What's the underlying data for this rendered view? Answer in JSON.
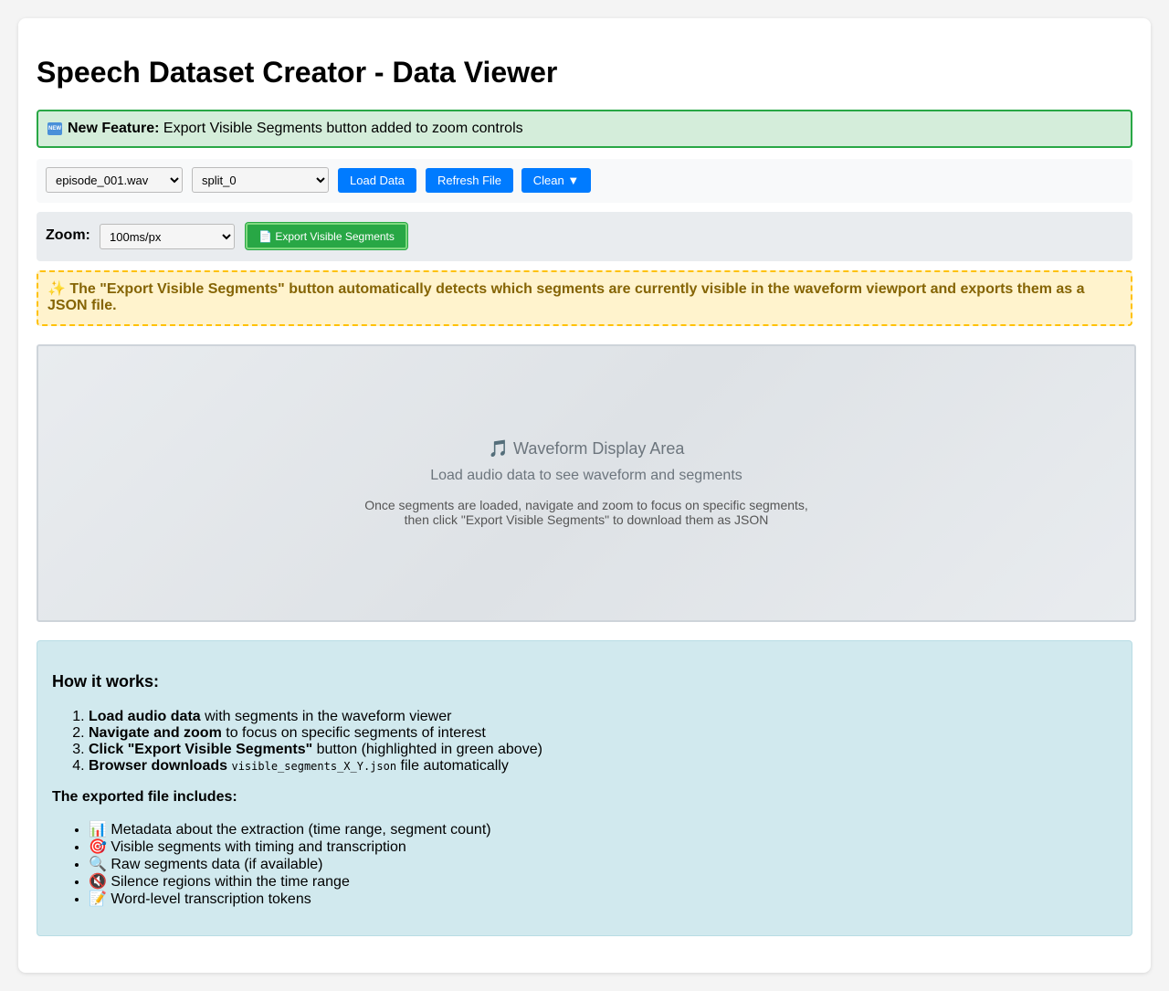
{
  "page": {
    "title": "Speech Dataset Creator - Data Viewer"
  },
  "banner": {
    "badge": "NEW",
    "strong": "New Feature:",
    "text": " Export Visible Segments button added to zoom controls"
  },
  "controls": {
    "file_selected": "episode_001.wav",
    "split_selected": "split_0",
    "load_label": "Load Data",
    "refresh_label": "Refresh File",
    "clean_label": "Clean ▼"
  },
  "zoom": {
    "label": "Zoom:",
    "selected": "100ms/px",
    "export_label": "📄 Export Visible Segments"
  },
  "tip": {
    "text": "✨ The \"Export Visible Segments\" button automatically detects which segments are currently visible in the waveform viewport and exports them as a JSON file."
  },
  "waveform": {
    "title": "🎵 Waveform Display Area",
    "subtitle": "Load audio data to see waveform and segments",
    "hint_line1": "Once segments are loaded, navigate and zoom to focus on specific segments,",
    "hint_line2": "then click \"Export Visible Segments\" to download them as JSON"
  },
  "how": {
    "heading": "How it works:",
    "steps": [
      {
        "strong": "Load audio data",
        "rest": " with segments in the waveform viewer"
      },
      {
        "strong": "Navigate and zoom",
        "rest": " to focus on specific segments of interest"
      },
      {
        "strong": "Click \"Export Visible Segments\"",
        "rest": " button (highlighted in green above)"
      },
      {
        "strong": "Browser downloads",
        "code": "visible_segments_X_Y.json",
        "rest": " file automatically"
      }
    ],
    "includes_heading": "The exported file includes:",
    "includes": [
      "📊 Metadata about the extraction (time range, segment count)",
      "🎯 Visible segments with timing and transcription",
      "🔍 Raw segments data (if available)",
      "🔇 Silence regions within the time range",
      "📝 Word-level transcription tokens"
    ]
  }
}
